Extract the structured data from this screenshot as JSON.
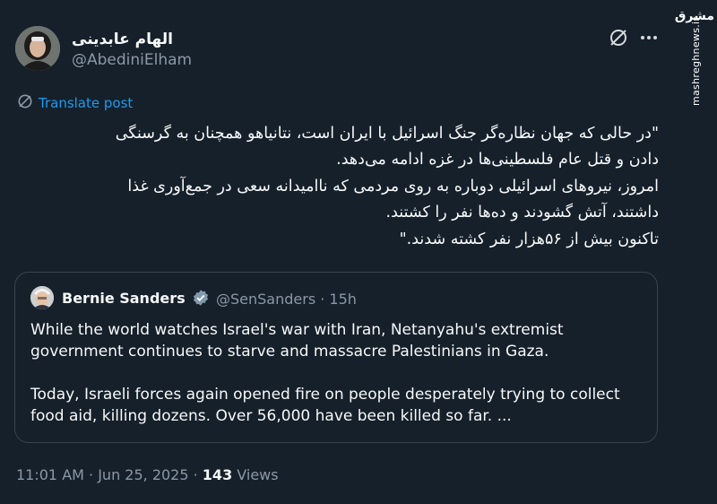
{
  "author": {
    "display_name": "الهام عابدینی",
    "handle": "@AbediniElham"
  },
  "translate_label": "Translate post",
  "tweet_lines": [
    "\"در حالی که جهان نظاره‌گر جنگ اسرائیل با ایران است، نتانیاهو همچنان به گرسنگی",
    "دادن و قتل عام فلسطینی‌ها در غزه ادامه می‌دهد.",
    "امروز، نیروهای اسرائیلی دوباره به روی مردمی که ناامیدانه سعی در جمع‌آوری غذا",
    "داشتند، آتش گشودند و ده‌ها نفر را کشتند.",
    "تاکنون بیش از ۵۶هزار نفر کشته شدند.\""
  ],
  "quote": {
    "name": "Bernie Sanders",
    "handle_time": "@SenSanders · 15h",
    "para1": [
      "While the world watches Israel's war with Iran, Netanyahu's extremist",
      "government continues to starve and massacre Palestinians in Gaza."
    ],
    "para2": [
      "Today, Israeli forces again opened fire on people desperately trying to collect",
      "food aid, killing dozens. Over 56,000 have been killed so far. ..."
    ]
  },
  "meta": {
    "time_date": "11:01 AM · Jun 25, 2025 · ",
    "views_count": "143",
    "views_label": " Views"
  },
  "watermark": {
    "logo": "مشرق",
    "site": "mashreghnews.ir"
  },
  "colors": {
    "background": "#15202b",
    "text": "#f7f9f9",
    "muted": "#8b98a5",
    "accent": "#1d9bf0",
    "border": "#38444d"
  },
  "icons": [
    "grok-icon",
    "more-icon",
    "translate-icon",
    "verified-badge-icon"
  ]
}
